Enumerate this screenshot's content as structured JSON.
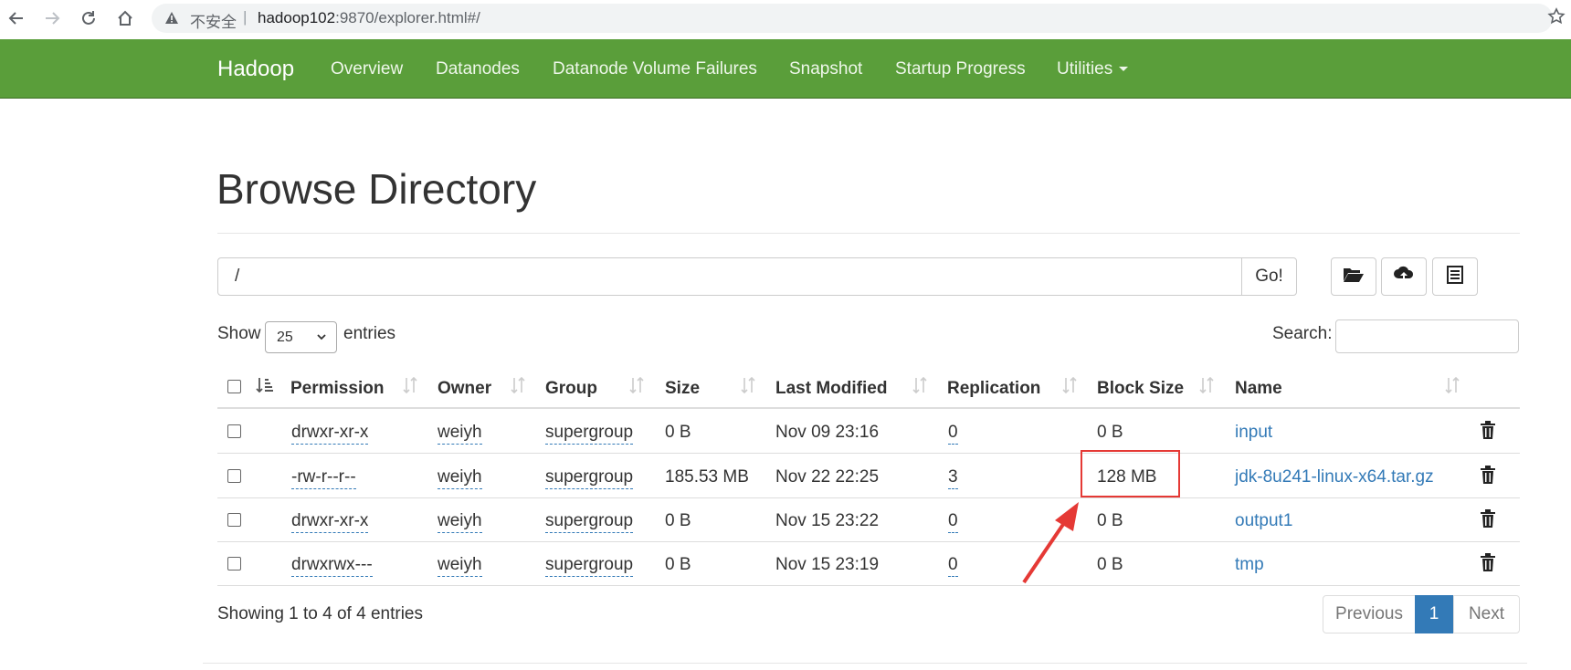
{
  "browser": {
    "back_icon": "arrow-left-icon",
    "forward_icon": "arrow-right-icon",
    "reload_icon": "reload-icon",
    "home_icon": "home-icon",
    "insecure_label": "不安全",
    "separator": "|",
    "url_host": "hadoop102",
    "url_path": ":9870/explorer.html#/",
    "bookmark_icon": "star-icon"
  },
  "navbar": {
    "brand": "Hadoop",
    "links": [
      "Overview",
      "Datanodes",
      "Datanode Volume Failures",
      "Snapshot",
      "Startup Progress",
      "Utilities"
    ],
    "color": "#5a9e3a"
  },
  "page": {
    "title": "Browse Directory",
    "path_value": "/",
    "go_label": "Go!",
    "toolbar_icons": [
      "folder-open-icon",
      "cloud-upload-icon",
      "list-icon"
    ]
  },
  "controls": {
    "show_label": "Show",
    "entries_value": "25",
    "entries_label": "entries",
    "search_label": "Search:"
  },
  "table": {
    "headers": [
      "Permission",
      "Owner",
      "Group",
      "Size",
      "Last Modified",
      "Replication",
      "Block Size",
      "Name"
    ],
    "rows": [
      {
        "permission": "drwxr-xr-x",
        "owner": "weiyh",
        "group": "supergroup",
        "size": "0 B",
        "modified": "Nov 09 23:16",
        "replication": "0",
        "block_size": "0 B",
        "name": "input"
      },
      {
        "permission": "-rw-r--r--",
        "owner": "weiyh",
        "group": "supergroup",
        "size": "185.53 MB",
        "modified": "Nov 22 22:25",
        "replication": "3",
        "block_size": "128 MB",
        "name": "jdk-8u241-linux-x64.tar.gz"
      },
      {
        "permission": "drwxr-xr-x",
        "owner": "weiyh",
        "group": "supergroup",
        "size": "0 B",
        "modified": "Nov 15 23:22",
        "replication": "0",
        "block_size": "0 B",
        "name": "output1"
      },
      {
        "permission": "drwxrwx---",
        "owner": "weiyh",
        "group": "supergroup",
        "size": "0 B",
        "modified": "Nov 15 23:19",
        "replication": "0",
        "block_size": "0 B",
        "name": "tmp"
      }
    ]
  },
  "footer": {
    "info": "Showing 1 to 4 of 4 entries",
    "previous": "Previous",
    "current_page": "1",
    "next": "Next"
  },
  "annotation": {
    "color": "#e53935"
  }
}
